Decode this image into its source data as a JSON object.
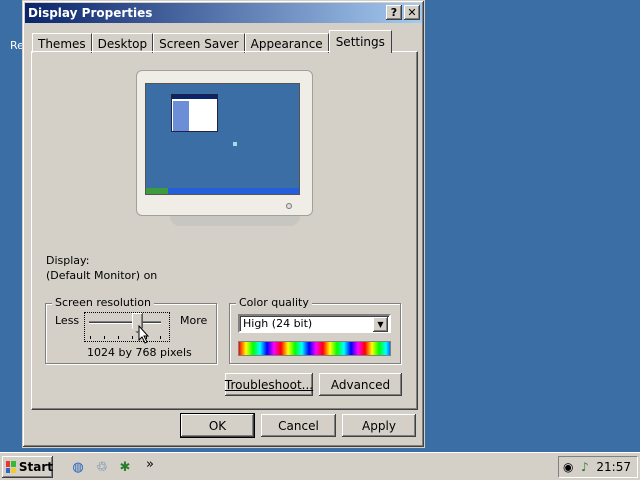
{
  "desktop": {
    "icon_label": "Re"
  },
  "window": {
    "title": "Display Properties",
    "help_btn": "?",
    "close_btn": "✕",
    "tabs": [
      "Themes",
      "Desktop",
      "Screen Saver",
      "Appearance",
      "Settings"
    ],
    "active_tab": "Settings"
  },
  "settings": {
    "display_label": "Display:",
    "display_value": "(Default Monitor) on",
    "resolution": {
      "legend": "Screen resolution",
      "less": "Less",
      "more": "More",
      "value": "1024 by 768 pixels",
      "slider_fraction": 0.67
    },
    "color_quality": {
      "legend": "Color quality",
      "selected": "High (24 bit)"
    },
    "troubleshoot_label": "Troubleshoot...",
    "advanced_label": "Advanced"
  },
  "dialog_buttons": {
    "ok": "OK",
    "cancel": "Cancel",
    "apply": "Apply"
  },
  "taskbar": {
    "start_label": "Start",
    "chevron": "»",
    "clock": "21:57"
  },
  "icons": [
    "help-icon",
    "close-icon",
    "monitor-icon",
    "dropdown-arrow-icon",
    "windows-flag-icon",
    "ie-icon",
    "recycle-icon",
    "settings-icon",
    "network-icon",
    "volume-icon"
  ]
}
